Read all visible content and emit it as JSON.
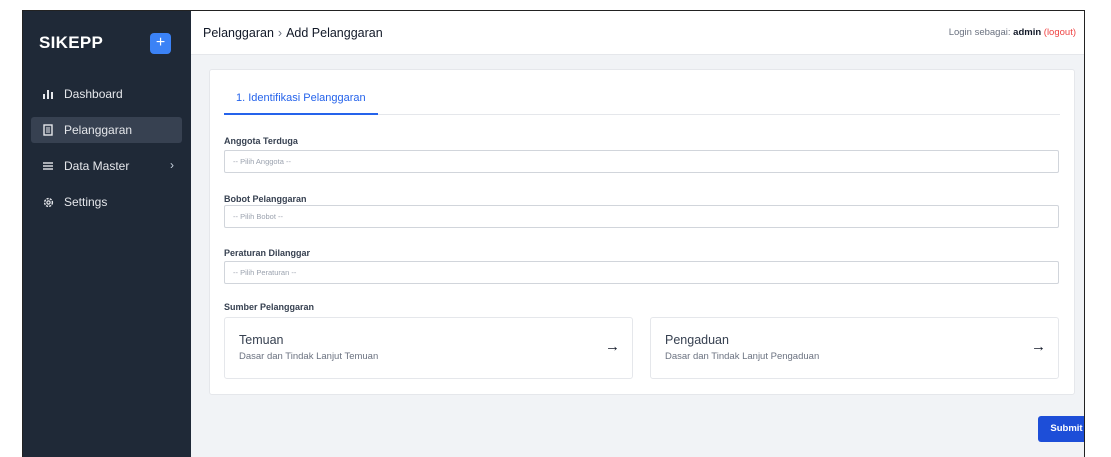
{
  "sidebar": {
    "brand": "SIKEPP",
    "add_icon": "plus-icon",
    "items": [
      {
        "label": "Dashboard",
        "icon": "bar-chart-icon"
      },
      {
        "label": "Pelanggaran",
        "icon": "document-icon"
      },
      {
        "label": "Data Master",
        "icon": "menu-icon",
        "chevron": "›"
      },
      {
        "label": "Settings",
        "icon": "gear-icon"
      }
    ]
  },
  "header": {
    "breadcrumb_parent": "Pelanggaran",
    "breadcrumb_sep": "›",
    "breadcrumb_current": "Add Pelanggaran",
    "login_prefix": "Login sebagai:",
    "login_user": "admin",
    "logout": "(logout)"
  },
  "form": {
    "tab": "1. Identifikasi Pelanggaran",
    "fields": [
      {
        "label": "Anggota Terduga",
        "placeholder": "-- Pilih Anggota --"
      },
      {
        "label": "Bobot Pelanggaran",
        "placeholder": "-- Pilih Bobot --"
      },
      {
        "label": "Peraturan Dilanggar",
        "placeholder": "-- Pilih Peraturan --"
      }
    ],
    "source_label": "Sumber Pelanggaran",
    "sources": [
      {
        "title": "Temuan",
        "desc": "Dasar dan Tindak Lanjut Temuan",
        "arrow": "→"
      },
      {
        "title": "Pengaduan",
        "desc": "Dasar dan Tindak Lanjut Pengaduan",
        "arrow": "→"
      }
    ],
    "submit": "Submit"
  },
  "colors": {
    "sidebar_bg": "#1f2937",
    "accent": "#2563eb",
    "submit_bg": "#1d4ed8",
    "logout": "#ef4444"
  }
}
